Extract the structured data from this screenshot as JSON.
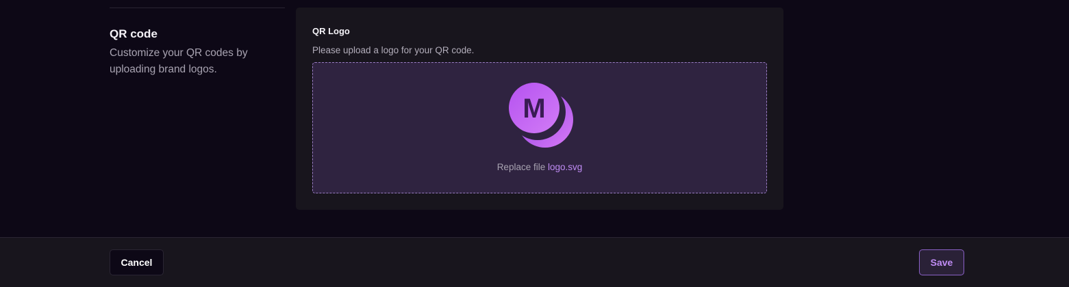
{
  "section": {
    "title": "QR code",
    "description": "Customize your QR codes by uploading brand logos."
  },
  "qr_logo": {
    "title": "QR Logo",
    "description": "Please upload a logo for your QR code.",
    "replace_label": "Replace file",
    "file_name": "logo.svg",
    "logo_letter": "M",
    "logo_icon": "brand-logo-icon"
  },
  "footer": {
    "cancel_label": "Cancel",
    "save_label": "Save"
  },
  "colors": {
    "background": "#0d0816",
    "card": "#18151d",
    "dropzone": "#2f2340",
    "accent": "#c08cf5",
    "logo_light": "#d074f5",
    "logo_dark": "#9b3fe6"
  }
}
